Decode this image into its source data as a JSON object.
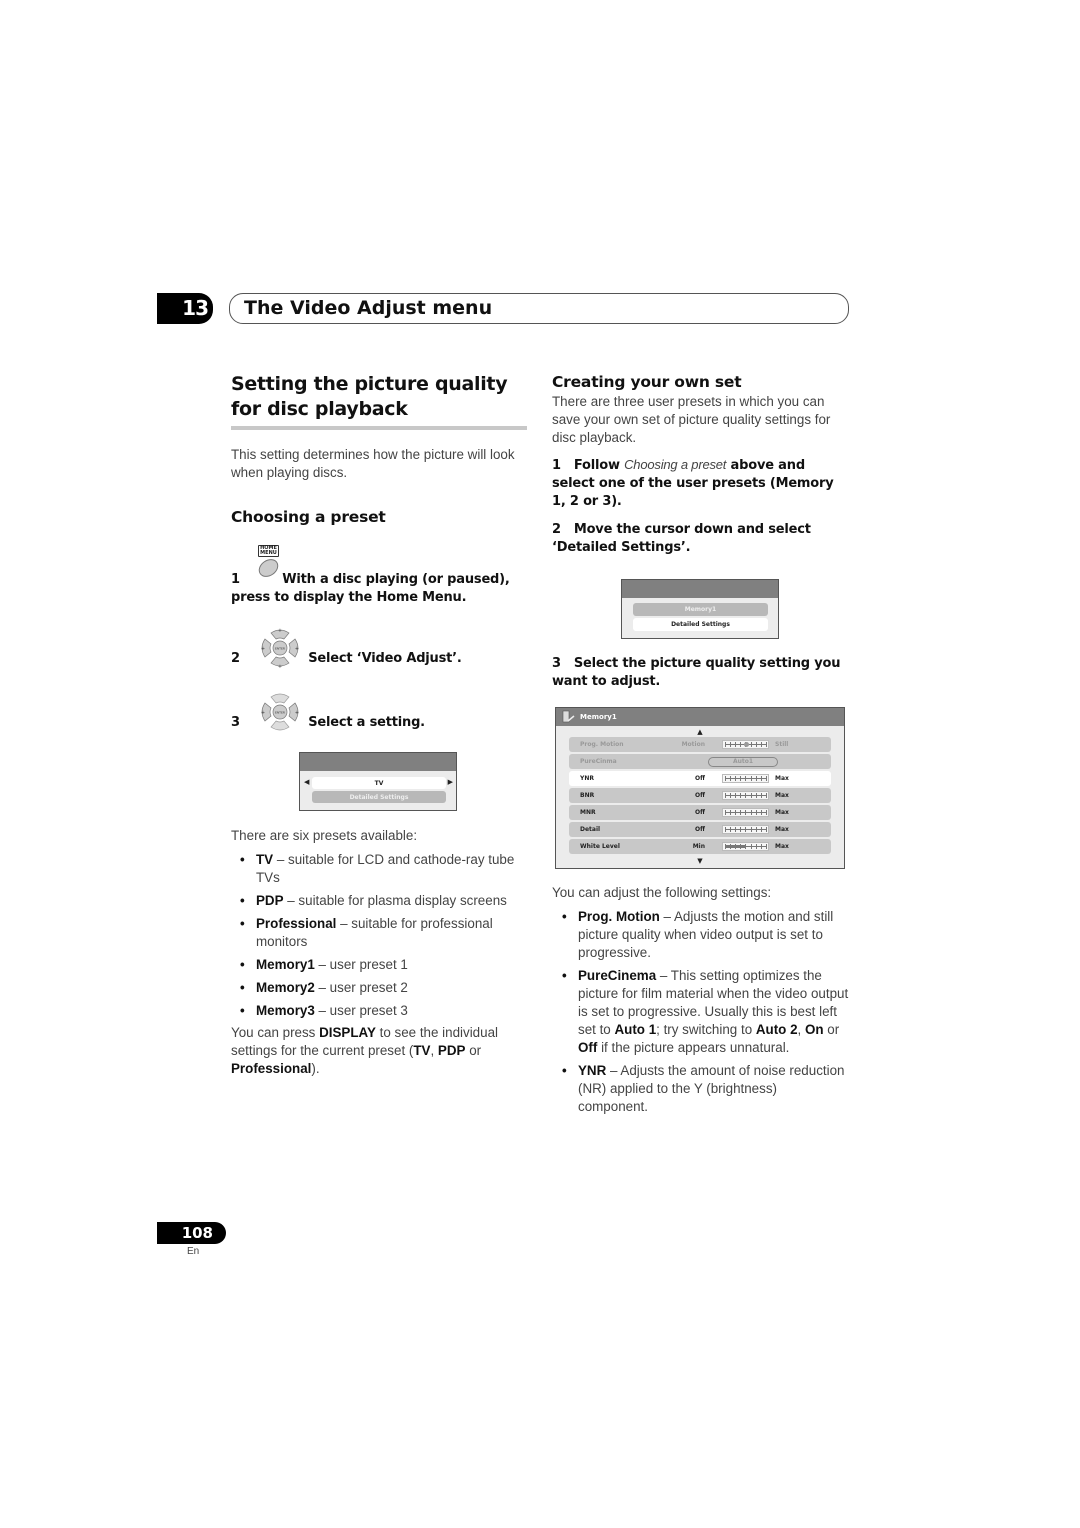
{
  "chapter": {
    "number": "13",
    "title": "The Video Adjust menu"
  },
  "left": {
    "section_title_line1": "Setting the picture quality",
    "section_title_line2": "for disc playback",
    "intro": "This setting determines how the picture will look when playing discs.",
    "subheading": "Choosing a preset",
    "steps": [
      {
        "num": "1",
        "icon": "home-menu-button-icon",
        "icon_label_1": "HOME",
        "icon_label_2": "MENU",
        "text_a": "With a disc playing (or paused),",
        "text_b": "press to display the Home Menu."
      },
      {
        "num": "2",
        "icon": "dpad-enter-icon",
        "text": "Select ‘Video Adjust’."
      },
      {
        "num": "3",
        "icon": "dpad-enter-icon",
        "text": "Select a setting."
      }
    ],
    "osd_preset": {
      "selected": "TV",
      "option": "Detailed Settings",
      "left_arrow": "◀",
      "right_arrow": "▶"
    },
    "presets_intro": "There are six presets available:",
    "presets": [
      {
        "name": "TV",
        "desc": " – suitable for LCD and cathode-ray tube TVs"
      },
      {
        "name": "PDP",
        "desc": " – suitable for plasma display screens"
      },
      {
        "name": "Professional",
        "desc": " – suitable for professional monitors"
      },
      {
        "name": "Memory1",
        "desc": " – user preset 1"
      },
      {
        "name": "Memory2",
        "desc": " – user preset 2"
      },
      {
        "name": "Memory3",
        "desc": " – user preset 3"
      }
    ],
    "display_note": {
      "a": "You can press ",
      "b": "DISPLAY",
      "c": " to see the individual settings for the current preset (",
      "d": "TV",
      "e": ", ",
      "f": "PDP",
      "g": " or ",
      "h": "Professional",
      "i": ")."
    }
  },
  "right": {
    "subheading": "Creating your own set",
    "intro": "There are three user presets in which you can save your own set of picture quality settings for disc playback.",
    "step1": {
      "num": "1",
      "a": "Follow ",
      "b": "Choosing a preset",
      "c": " above and select one of the user presets (Memory 1, 2 or 3)."
    },
    "step2": {
      "num": "2",
      "text": "Move the cursor down and select ‘Detailed Settings’."
    },
    "osd_memory": {
      "selected": "Memory1",
      "option": "Detailed Settings"
    },
    "step3": {
      "num": "3",
      "text": "Select the picture quality setting you want to adjust."
    },
    "osd_detail": {
      "title": "Memory1",
      "up_arrow": "▲",
      "down_arrow": "▼",
      "rows": [
        {
          "label": "Prog. Motion",
          "left": "Motion",
          "right": "Still",
          "type": "slider",
          "value": 0.5,
          "dimmed": true
        },
        {
          "label": "PureCinma",
          "value_text": "Auto1",
          "type": "pill",
          "dimmed": true
        },
        {
          "label": "YNR",
          "left": "Off",
          "right": "Max",
          "type": "slider",
          "value": 0,
          "highlight": true
        },
        {
          "label": "BNR",
          "left": "Off",
          "right": "Max",
          "type": "slider",
          "value": 0
        },
        {
          "label": "MNR",
          "left": "Off",
          "right": "Max",
          "type": "slider",
          "value": 0
        },
        {
          "label": "Detail",
          "left": "Off",
          "right": "Max",
          "type": "slider",
          "value": 0
        },
        {
          "label": "White Level",
          "left": "Min",
          "right": "Max",
          "type": "fill",
          "value": 0.5
        }
      ]
    },
    "adjust_intro": "You can adjust the following settings:",
    "settings": [
      {
        "name": "Prog. Motion",
        "desc": " – Adjusts the motion and still picture quality when video output is set to progressive."
      },
      {
        "name": "PureCinema",
        "desc_parts": [
          " – This setting optimizes the picture for film material when the video output is set to progressive. Usually this is best left set to ",
          "Auto 1",
          "; try switching to ",
          "Auto 2",
          ", ",
          "On",
          " or ",
          "Off",
          " if the picture appears unnatural."
        ]
      },
      {
        "name": "YNR",
        "desc": " – Adjusts the amount of noise reduction (NR) applied to the Y (brightness) component."
      }
    ]
  },
  "footer": {
    "page_number": "108",
    "language": "En"
  }
}
